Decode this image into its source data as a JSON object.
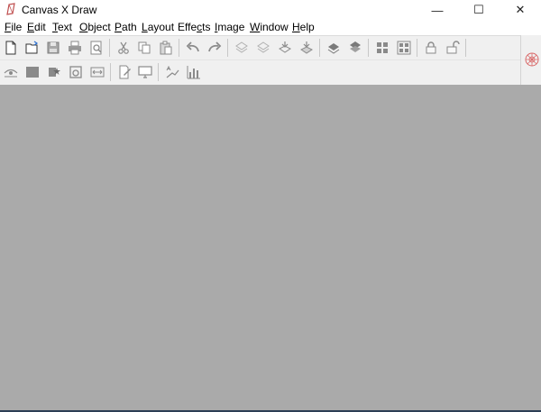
{
  "window": {
    "title": "Canvas X Draw",
    "controls": {
      "minimize": "—",
      "maximize": "☐",
      "close": "✕"
    }
  },
  "menu": [
    {
      "label": "File",
      "u": "F",
      "rest": "ile"
    },
    {
      "label": "Edit",
      "u": "E",
      "rest": "dit"
    },
    {
      "label": "Text",
      "u": "T",
      "rest": "ext"
    },
    {
      "label": "Object",
      "u": "O",
      "rest": "bject"
    },
    {
      "label": "Path",
      "u": "P",
      "rest": "ath"
    },
    {
      "label": "Layout",
      "u": "L",
      "rest": "ayout"
    },
    {
      "label": "Effects",
      "pre": "Effe",
      "u": "c",
      "rest": "ts"
    },
    {
      "label": "Image",
      "u": "I",
      "rest": "mage"
    },
    {
      "label": "Window",
      "u": "W",
      "rest": "indow"
    },
    {
      "label": "Help",
      "u": "H",
      "rest": "elp"
    }
  ],
  "toolbar1": [
    "new-document-icon",
    "open-file-icon",
    "save-icon",
    "print-icon",
    "print-preview-icon",
    "cut-icon",
    "copy-icon",
    "paste-icon",
    "undo-icon",
    "redo-icon",
    "bring-forward-icon",
    "send-backward-icon",
    "bring-to-front-icon",
    "send-to-back-icon",
    "group-icon",
    "ungroup-icon",
    "align-icon",
    "distribute-icon",
    "lock-icon",
    "unlock-icon"
  ],
  "toolbar2": [
    "visibility-icon",
    "fill-icon",
    "effects-icon",
    "shape-icon",
    "resize-icon",
    "edit-document-icon",
    "display-icon",
    "text-chart-icon",
    "bar-chart-icon"
  ],
  "colors": {
    "canvas": "#aaaaaa",
    "toolbar": "#f0f0f0",
    "icon_gray": "#8a8a8a",
    "accent": "#d96a6a"
  }
}
